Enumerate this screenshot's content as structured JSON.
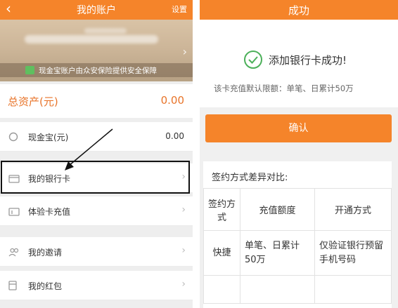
{
  "left": {
    "header": {
      "back_icon": "chevron-left-icon",
      "title": "我的账户",
      "settings_label": "设置"
    },
    "banner": {
      "note": "现金宝账户由众安保险提供安全保障"
    },
    "assets": {
      "label": "总资产(元)",
      "value": "0.00"
    },
    "rows": [
      {
        "icon": "cash-icon",
        "label": "现金宝(元)",
        "amount": "0.00"
      },
      {
        "icon": "card-icon",
        "label": "我的银行卡"
      },
      {
        "icon": "gift-card-icon",
        "label": "体验卡充值"
      },
      {
        "icon": "people-icon",
        "label": "我的邀请"
      },
      {
        "icon": "red-packet-icon",
        "label": "我的红包"
      }
    ]
  },
  "right": {
    "header": {
      "title": "成功"
    },
    "success": {
      "icon": "check-circle-icon",
      "title": "添加银行卡成功!",
      "limit_note": "该卡充值默认限额：单笔、日累计50万"
    },
    "confirm_label": "确认",
    "compare": {
      "title": "签约方式差异对比:",
      "headers": [
        "签约方式",
        "充值额度",
        "开通方式"
      ],
      "rows": [
        [
          "快捷",
          "单笔、日累计50万",
          "仅验证银行预留手机号码"
        ]
      ]
    }
  },
  "colors": {
    "accent": "#f5842a",
    "success": "#4cb05a",
    "highlight_border": "#111111"
  }
}
